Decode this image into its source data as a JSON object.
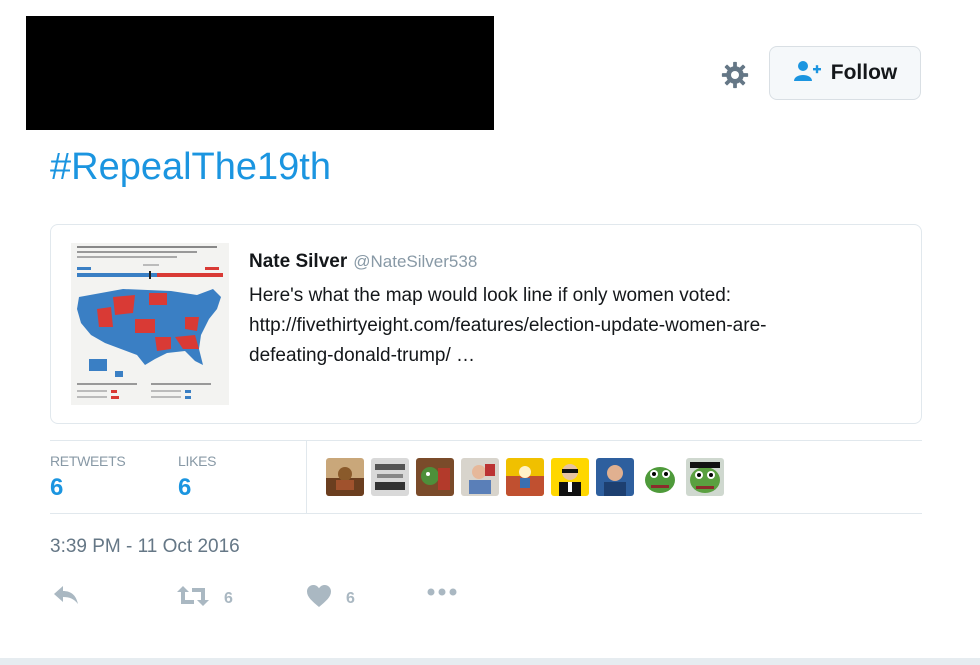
{
  "header": {
    "follow_label": "Follow"
  },
  "tweet": {
    "hashtag": "#RepealThe19th",
    "quoted": {
      "name": "Nate Silver",
      "handle": "@NateSilver538",
      "text_line1": "Here's what the map would look line if only women voted:",
      "text_line2": "http://fivethirtyeight.com/features/election-update-women-are-",
      "text_line3": "defeating-donald-trump/ …"
    },
    "stats": {
      "retweets_label": "RETWEETS",
      "retweets_count": "6",
      "likes_label": "LIKES",
      "likes_count": "6"
    },
    "timestamp": "3:39 PM - 11 Oct 2016",
    "actions": {
      "retweet_count": "6",
      "like_count": "6"
    }
  },
  "colors": {
    "link_blue": "#1b95e0",
    "muted_gray": "#8899a6",
    "map_blue": "#3a7fc4",
    "map_red": "#d93a35"
  },
  "icons": [
    "gear-icon",
    "add-user-icon",
    "reply-icon",
    "retweet-icon",
    "heart-icon",
    "more-icon"
  ]
}
